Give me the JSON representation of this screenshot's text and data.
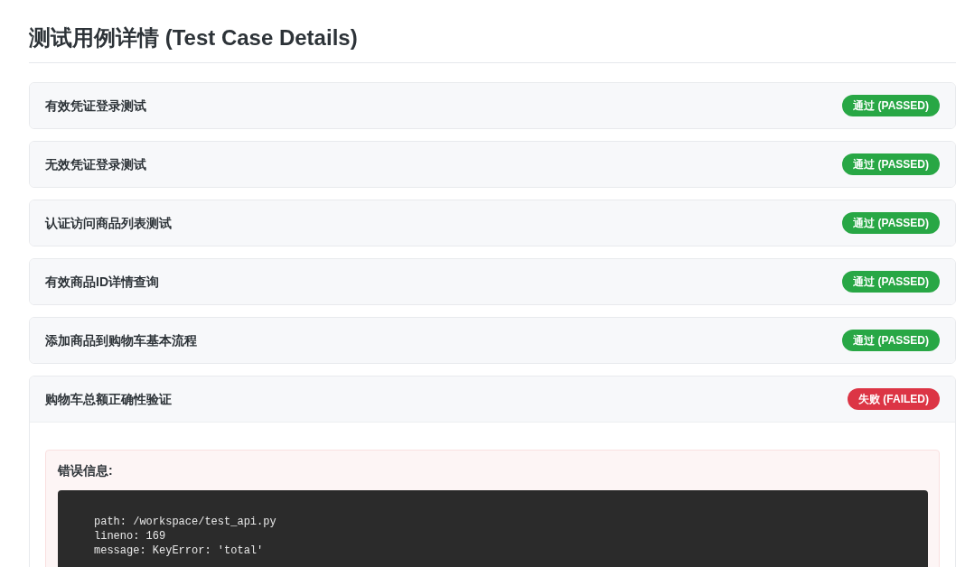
{
  "title": "测试用例详情 (Test Case Details)",
  "test_cases": [
    {
      "name": "有效凭证登录测试",
      "kind": "passed",
      "badge": "通过 (PASSED)"
    },
    {
      "name": "无效凭证登录测试",
      "kind": "passed",
      "badge": "通过 (PASSED)"
    },
    {
      "name": "认证访问商品列表测试",
      "kind": "passed",
      "badge": "通过 (PASSED)"
    },
    {
      "name": "有效商品ID详情查询",
      "kind": "passed",
      "badge": "通过 (PASSED)"
    },
    {
      "name": "添加商品到购物车基本流程",
      "kind": "passed",
      "badge": "通过 (PASSED)"
    },
    {
      "name": "购物车总额正确性验证",
      "kind": "failed",
      "badge": "失败 (FAILED)",
      "error": {
        "label": "错误信息:",
        "lines": [
          "path: /workspace/test_api.py",
          "lineno: 169",
          "message: KeyError: 'total'"
        ]
      }
    }
  ]
}
